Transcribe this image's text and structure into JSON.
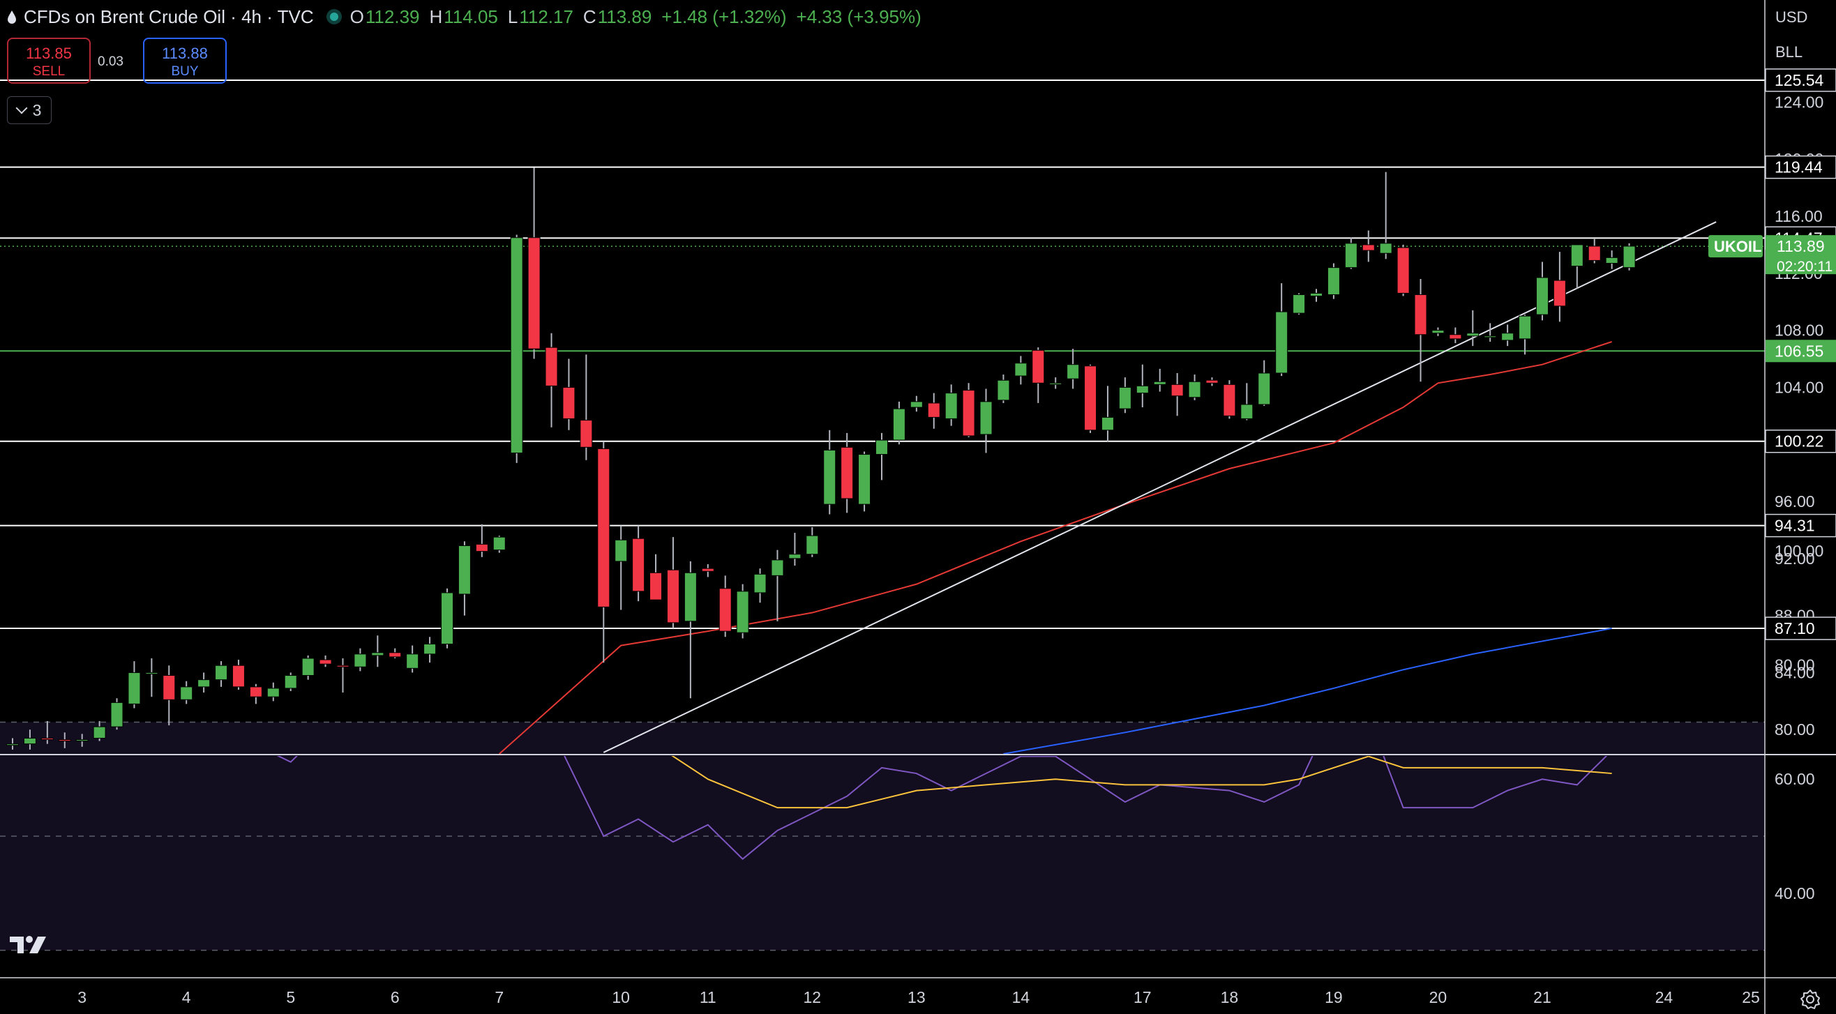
{
  "header": {
    "title": "CFDs on Brent Crude Oil · 4h · TVC",
    "ohlc": [
      {
        "k": "O",
        "v": "112.39"
      },
      {
        "k": "H",
        "v": "114.05"
      },
      {
        "k": "L",
        "v": "112.17"
      },
      {
        "k": "C",
        "v": "113.89"
      }
    ],
    "change": "+1.48 (+1.32%)",
    "change2": "+4.33 (+3.95%)"
  },
  "trade": {
    "sell_price": "113.85",
    "sell_label": "SELL",
    "spread": "0.03",
    "buy_price": "113.88",
    "buy_label": "BUY"
  },
  "indicators_count": "3",
  "axis": {
    "currency": "USD",
    "unit": "BLL"
  },
  "colors": {
    "up": "#4caf50",
    "down": "#f23645",
    "ma50": "#e53935",
    "ma200": "#2962ff",
    "rsi": "#7e57c2",
    "rsi_ma": "#f9c23c",
    "level": "#ffffff",
    "support": "#4caf50"
  },
  "icons": [
    "drop-icon",
    "chevron-down-icon",
    "tradingview-logo-icon",
    "settings-icon"
  ],
  "chart_data": [
    {
      "type": "candlestick",
      "symbol": "UKOIL",
      "countdown": "02:20:11",
      "y_ticks": [
        "124.00",
        "120.00",
        "116.00",
        "112.00",
        "108.00",
        "104.00",
        "96.00",
        "92.00",
        "88.00",
        "84.00",
        "80.00"
      ],
      "ylim": [
        78.3,
        129.5
      ],
      "x_ticks": [
        {
          "label": "3",
          "i": 4
        },
        {
          "label": "4",
          "i": 10
        },
        {
          "label": "5",
          "i": 16
        },
        {
          "label": "6",
          "i": 22
        },
        {
          "label": "7",
          "i": 28
        },
        {
          "label": "10",
          "i": 35
        },
        {
          "label": "11",
          "i": 40
        },
        {
          "label": "12",
          "i": 46
        },
        {
          "label": "13",
          "i": 52
        },
        {
          "label": "14",
          "i": 58
        },
        {
          "label": "17",
          "i": 65
        },
        {
          "label": "18",
          "i": 70
        },
        {
          "label": "19",
          "i": 76
        },
        {
          "label": "20",
          "i": 82
        },
        {
          "label": "21",
          "i": 88
        },
        {
          "label": "24",
          "i": 95
        },
        {
          "label": "25",
          "i": 100
        }
      ],
      "levels": [
        {
          "label": "125.54",
          "value": 125.54,
          "kind": "resistance"
        },
        {
          "label": "119.44",
          "value": 119.44,
          "kind": "resistance"
        },
        {
          "label": "114.47",
          "value": 114.47,
          "kind": "resistance"
        },
        {
          "label": "106.55",
          "value": 106.55,
          "kind": "support"
        },
        {
          "label": "100.22",
          "value": 100.22,
          "kind": "resistance"
        },
        {
          "label": "94.31",
          "value": 94.31,
          "kind": "resistance"
        },
        {
          "label": "87.10",
          "value": 87.1,
          "kind": "resistance"
        }
      ],
      "last_price": "113.89",
      "candles": [
        [
          78.9,
          79.4,
          78.6,
          79.0
        ],
        [
          79.0,
          80.0,
          78.6,
          79.4
        ],
        [
          79.4,
          80.6,
          79.0,
          79.3
        ],
        [
          79.3,
          79.8,
          78.7,
          79.2
        ],
        [
          79.2,
          79.7,
          78.8,
          79.3
        ],
        [
          79.4,
          80.6,
          79.2,
          80.2
        ],
        [
          80.2,
          82.2,
          80.0,
          81.9
        ],
        [
          81.8,
          84.8,
          81.5,
          84.0
        ],
        [
          84.0,
          85.0,
          82.3,
          84.0
        ],
        [
          83.8,
          84.5,
          80.3,
          82.1
        ],
        [
          82.1,
          83.4,
          81.8,
          83.0
        ],
        [
          83.0,
          84.0,
          82.6,
          83.5
        ],
        [
          83.5,
          84.8,
          83.0,
          84.5
        ],
        [
          84.5,
          84.9,
          82.8,
          83.0
        ],
        [
          83.0,
          83.2,
          81.8,
          82.3
        ],
        [
          82.3,
          83.3,
          82.0,
          82.9
        ],
        [
          82.9,
          84.0,
          82.7,
          83.8
        ],
        [
          83.8,
          85.2,
          83.5,
          85.0
        ],
        [
          84.9,
          85.2,
          84.4,
          84.6
        ],
        [
          84.5,
          85.0,
          82.6,
          84.4
        ],
        [
          84.4,
          85.7,
          84.1,
          85.3
        ],
        [
          85.2,
          86.6,
          84.4,
          85.4
        ],
        [
          85.4,
          85.7,
          85.0,
          85.1
        ],
        [
          84.3,
          85.9,
          84.0,
          85.3
        ],
        [
          85.3,
          86.5,
          84.7,
          86.0
        ],
        [
          86.0,
          89.9,
          85.7,
          89.6
        ],
        [
          89.5,
          93.2,
          88.0,
          92.9
        ],
        [
          93.0,
          94.4,
          92.1,
          92.5
        ],
        [
          92.6,
          93.6,
          92.4,
          93.5
        ],
        [
          99.4,
          114.7,
          98.7,
          114.5
        ],
        [
          114.5,
          119.4,
          106.0,
          106.7
        ],
        [
          106.8,
          107.8,
          101.2,
          104.1
        ],
        [
          104.0,
          106.0,
          101.0,
          101.8
        ],
        [
          101.7,
          106.3,
          98.9,
          99.8
        ],
        [
          99.7,
          100.2,
          84.7,
          88.6
        ],
        [
          91.8,
          94.3,
          88.4,
          93.3
        ],
        [
          93.4,
          94.3,
          89.0,
          89.7
        ],
        [
          91.0,
          92.3,
          89.1,
          89.1
        ],
        [
          91.2,
          93.5,
          87.1,
          87.5
        ],
        [
          87.6,
          91.8,
          82.2,
          91.0
        ],
        [
          91.3,
          91.6,
          90.7,
          91.1
        ],
        [
          89.9,
          90.8,
          86.5,
          86.9
        ],
        [
          86.8,
          90.2,
          86.4,
          89.7
        ],
        [
          89.6,
          91.3,
          88.9,
          90.9
        ],
        [
          90.8,
          92.6,
          87.6,
          91.9
        ],
        [
          92.0,
          93.8,
          91.5,
          92.3
        ],
        [
          92.3,
          94.2,
          92.1,
          93.6
        ],
        [
          95.8,
          101.0,
          95.1,
          99.6
        ],
        [
          99.8,
          100.8,
          95.2,
          96.2
        ],
        [
          95.8,
          99.5,
          95.3,
          99.3
        ],
        [
          99.3,
          100.8,
          97.5,
          100.3
        ],
        [
          100.3,
          103.0,
          100.0,
          102.5
        ],
        [
          102.6,
          103.4,
          102.3,
          103.0
        ],
        [
          102.9,
          103.6,
          101.1,
          101.9
        ],
        [
          101.8,
          104.2,
          101.3,
          103.6
        ],
        [
          103.8,
          104.3,
          100.5,
          100.6
        ],
        [
          100.7,
          103.9,
          99.4,
          103.0
        ],
        [
          103.1,
          104.9,
          102.9,
          104.5
        ],
        [
          104.8,
          106.2,
          104.2,
          105.7
        ],
        [
          106.6,
          106.8,
          102.9,
          104.3
        ],
        [
          104.2,
          104.7,
          103.9,
          104.3
        ],
        [
          104.6,
          106.7,
          103.9,
          105.6
        ],
        [
          105.5,
          105.6,
          100.8,
          101.0
        ],
        [
          101.0,
          104.1,
          100.2,
          101.9
        ],
        [
          102.5,
          104.7,
          102.2,
          104.0
        ],
        [
          103.6,
          105.6,
          102.6,
          104.1
        ],
        [
          104.2,
          105.3,
          103.7,
          104.4
        ],
        [
          104.2,
          105.0,
          102.0,
          103.4
        ],
        [
          103.3,
          104.9,
          103.1,
          104.4
        ],
        [
          104.5,
          104.7,
          104.1,
          104.3
        ],
        [
          104.2,
          104.5,
          101.8,
          102.0
        ],
        [
          101.8,
          104.3,
          101.7,
          102.8
        ],
        [
          102.8,
          105.9,
          102.7,
          105.0
        ],
        [
          105.0,
          111.3,
          104.8,
          109.3
        ],
        [
          109.2,
          110.6,
          109.1,
          110.5
        ],
        [
          110.4,
          110.9,
          110.0,
          110.6
        ],
        [
          110.5,
          112.7,
          110.2,
          112.4
        ],
        [
          112.4,
          114.5,
          112.3,
          114.1
        ],
        [
          114.0,
          115.0,
          112.8,
          113.6
        ],
        [
          113.4,
          119.1,
          113.0,
          114.1
        ],
        [
          113.8,
          114.0,
          110.4,
          110.6
        ],
        [
          110.5,
          111.6,
          104.4,
          107.7
        ],
        [
          107.8,
          108.2,
          107.6,
          108.0
        ],
        [
          107.7,
          108.2,
          107.1,
          107.4
        ],
        [
          107.6,
          109.4,
          106.9,
          107.8
        ],
        [
          107.6,
          108.5,
          107.2,
          107.6
        ],
        [
          107.3,
          108.4,
          106.9,
          107.8
        ],
        [
          107.4,
          109.1,
          106.3,
          109.0
        ],
        [
          109.1,
          112.8,
          108.7,
          111.7
        ],
        [
          111.5,
          113.5,
          108.6,
          109.7
        ],
        [
          112.5,
          114.0,
          110.9,
          114.0
        ],
        [
          113.9,
          114.4,
          112.7,
          112.9
        ],
        [
          112.7,
          113.6,
          112.3,
          113.1
        ],
        [
          112.4,
          114.1,
          112.2,
          113.9
        ]
      ],
      "ma50": [
        [
          28,
          78.3
        ],
        [
          35,
          85.9
        ],
        [
          40,
          86.9
        ],
        [
          46,
          88.2
        ],
        [
          52,
          90.2
        ],
        [
          58,
          93.2
        ],
        [
          64,
          95.8
        ],
        [
          70,
          98.3
        ],
        [
          76,
          100.1
        ],
        [
          80,
          102.6
        ],
        [
          82,
          104.3
        ],
        [
          85,
          104.9
        ],
        [
          88,
          105.6
        ],
        [
          90,
          106.4
        ],
        [
          92,
          107.2
        ]
      ],
      "ma200": [
        [
          57,
          78.3
        ],
        [
          64,
          79.8
        ],
        [
          72,
          81.7
        ],
        [
          76,
          82.9
        ],
        [
          80,
          84.2
        ],
        [
          84,
          85.3
        ],
        [
          88,
          86.2
        ],
        [
          92,
          87.1
        ]
      ],
      "trendline": [
        [
          34,
          78.4
        ],
        [
          98,
          115.6
        ]
      ]
    },
    {
      "type": "line",
      "name": "RSI",
      "y_ticks": [
        "100.00",
        "80.00",
        "60.00",
        "40.00"
      ],
      "ylim": [
        28,
        100
      ],
      "bands": [
        70,
        50,
        30
      ],
      "rsi": [
        [
          0,
          78
        ],
        [
          2,
          77
        ],
        [
          4,
          70
        ],
        [
          6,
          74
        ],
        [
          8,
          84
        ],
        [
          9,
          82
        ],
        [
          10,
          70
        ],
        [
          12,
          76
        ],
        [
          13,
          77
        ],
        [
          14,
          66
        ],
        [
          16,
          63
        ],
        [
          18,
          69
        ],
        [
          20,
          68
        ],
        [
          22,
          72
        ],
        [
          24,
          80
        ],
        [
          26,
          84
        ],
        [
          28,
          93
        ],
        [
          30,
          75
        ],
        [
          34,
          50
        ],
        [
          36,
          53
        ],
        [
          38,
          49
        ],
        [
          40,
          52
        ],
        [
          42,
          46
        ],
        [
          44,
          51
        ],
        [
          48,
          57
        ],
        [
          50,
          62
        ],
        [
          52,
          61
        ],
        [
          54,
          58
        ],
        [
          58,
          64
        ],
        [
          60,
          64
        ],
        [
          64,
          56
        ],
        [
          66,
          59
        ],
        [
          70,
          58
        ],
        [
          72,
          56
        ],
        [
          74,
          59
        ],
        [
          76,
          72
        ],
        [
          78,
          71
        ],
        [
          80,
          55
        ],
        [
          84,
          55
        ],
        [
          86,
          58
        ],
        [
          88,
          60
        ],
        [
          90,
          59
        ],
        [
          92,
          65
        ]
      ],
      "rsi_ma": [
        [
          0,
          66
        ],
        [
          4,
          72
        ],
        [
          8,
          77
        ],
        [
          10,
          75
        ],
        [
          12,
          73
        ],
        [
          16,
          71
        ],
        [
          20,
          69
        ],
        [
          24,
          71
        ],
        [
          28,
          75
        ],
        [
          32,
          73
        ],
        [
          36,
          68
        ],
        [
          40,
          60
        ],
        [
          44,
          55
        ],
        [
          48,
          55
        ],
        [
          52,
          58
        ],
        [
          56,
          59
        ],
        [
          60,
          60
        ],
        [
          64,
          59
        ],
        [
          68,
          59
        ],
        [
          72,
          59
        ],
        [
          74,
          60
        ],
        [
          78,
          64
        ],
        [
          80,
          62
        ],
        [
          84,
          62
        ],
        [
          88,
          62
        ],
        [
          92,
          61
        ]
      ]
    }
  ]
}
